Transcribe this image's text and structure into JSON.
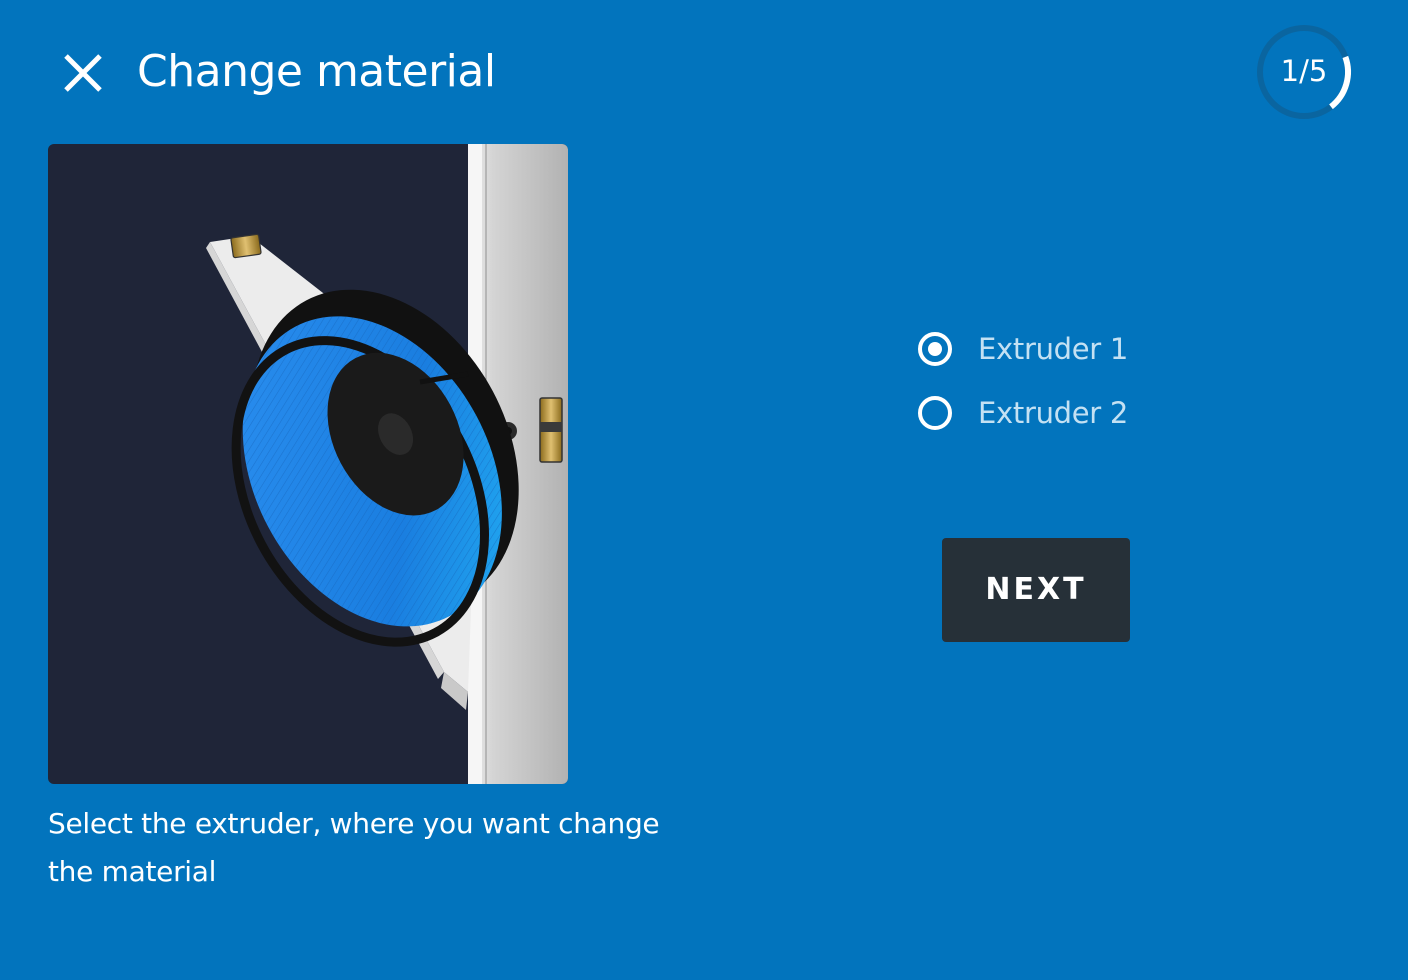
{
  "header": {
    "title": "Change material",
    "close_icon": "close-icon",
    "step": {
      "text": "1/5",
      "current": 1,
      "total": 5
    }
  },
  "illustration": {
    "subject": "filament-spool-holder",
    "spool_color": "#1e88e5"
  },
  "instructions": "Select the extruder, where you want change the material",
  "extruders": {
    "options": [
      {
        "label": "Extruder 1",
        "selected": true
      },
      {
        "label": "Extruder 2",
        "selected": false
      }
    ]
  },
  "next_button": {
    "label": "NEXT"
  },
  "colors": {
    "background": "#0274bd",
    "button": "#263038",
    "text": "#ffffff",
    "radio_label": "#c4e1f3"
  }
}
